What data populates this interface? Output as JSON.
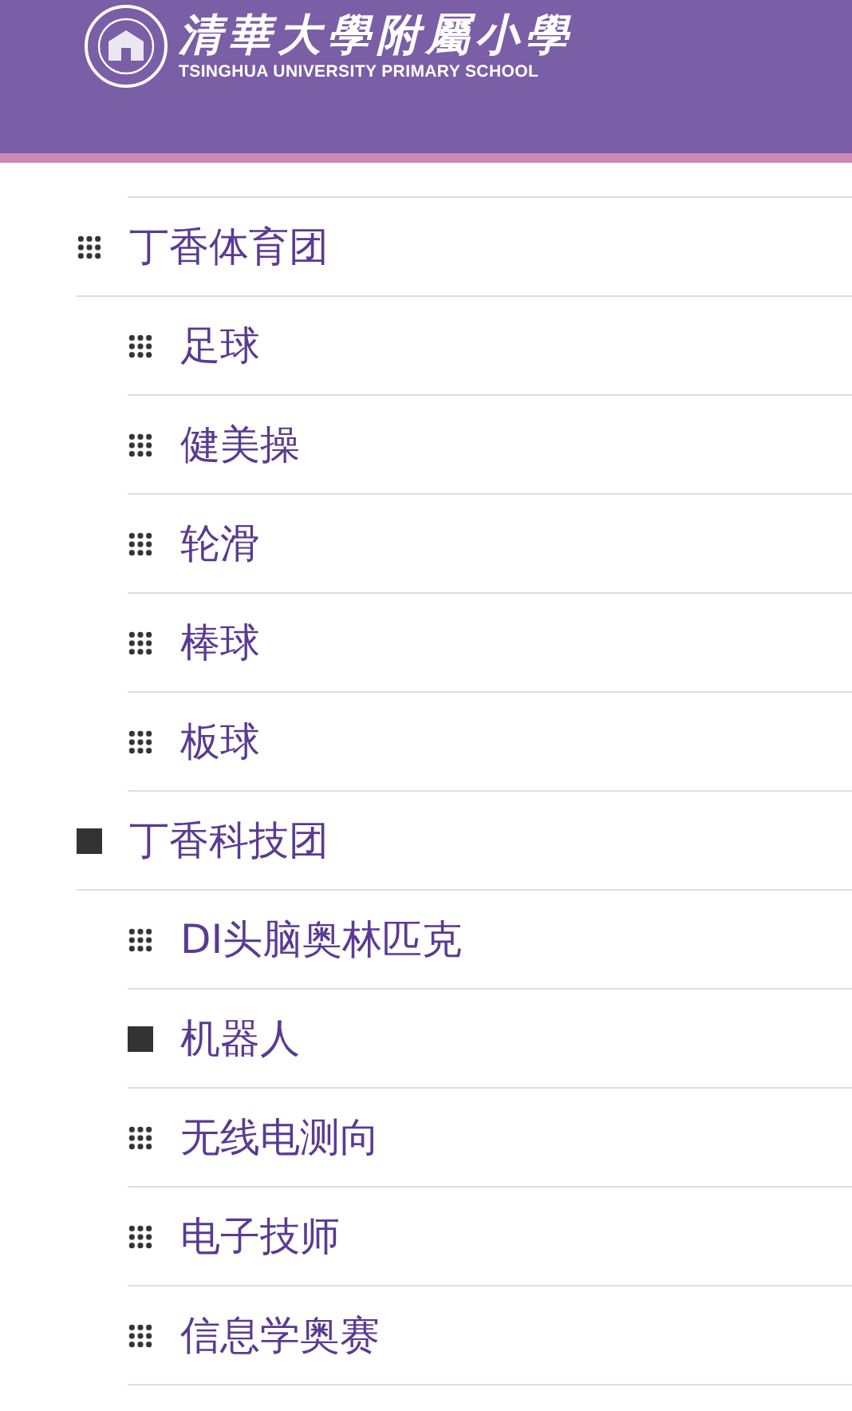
{
  "header": {
    "logo_title": "清華大學附屬小學",
    "logo_subtitle": "TSINGHUA UNIVERSITY PRIMARY SCHOOL"
  },
  "menu": [
    {
      "label": "丁香体育团",
      "kind": "grid",
      "children": [
        {
          "label": "足球",
          "kind": "grid"
        },
        {
          "label": "健美操",
          "kind": "grid"
        },
        {
          "label": "轮滑",
          "kind": "grid"
        },
        {
          "label": "棒球",
          "kind": "grid"
        },
        {
          "label": "板球",
          "kind": "grid"
        }
      ]
    },
    {
      "label": "丁香科技团",
      "kind": "square",
      "children": [
        {
          "label": "DI头脑奥林匹克",
          "kind": "grid"
        },
        {
          "label": "机器人",
          "kind": "square"
        },
        {
          "label": "无线电测向",
          "kind": "grid"
        },
        {
          "label": "电子技师",
          "kind": "grid"
        },
        {
          "label": "信息学奥赛",
          "kind": "grid"
        }
      ]
    }
  ]
}
